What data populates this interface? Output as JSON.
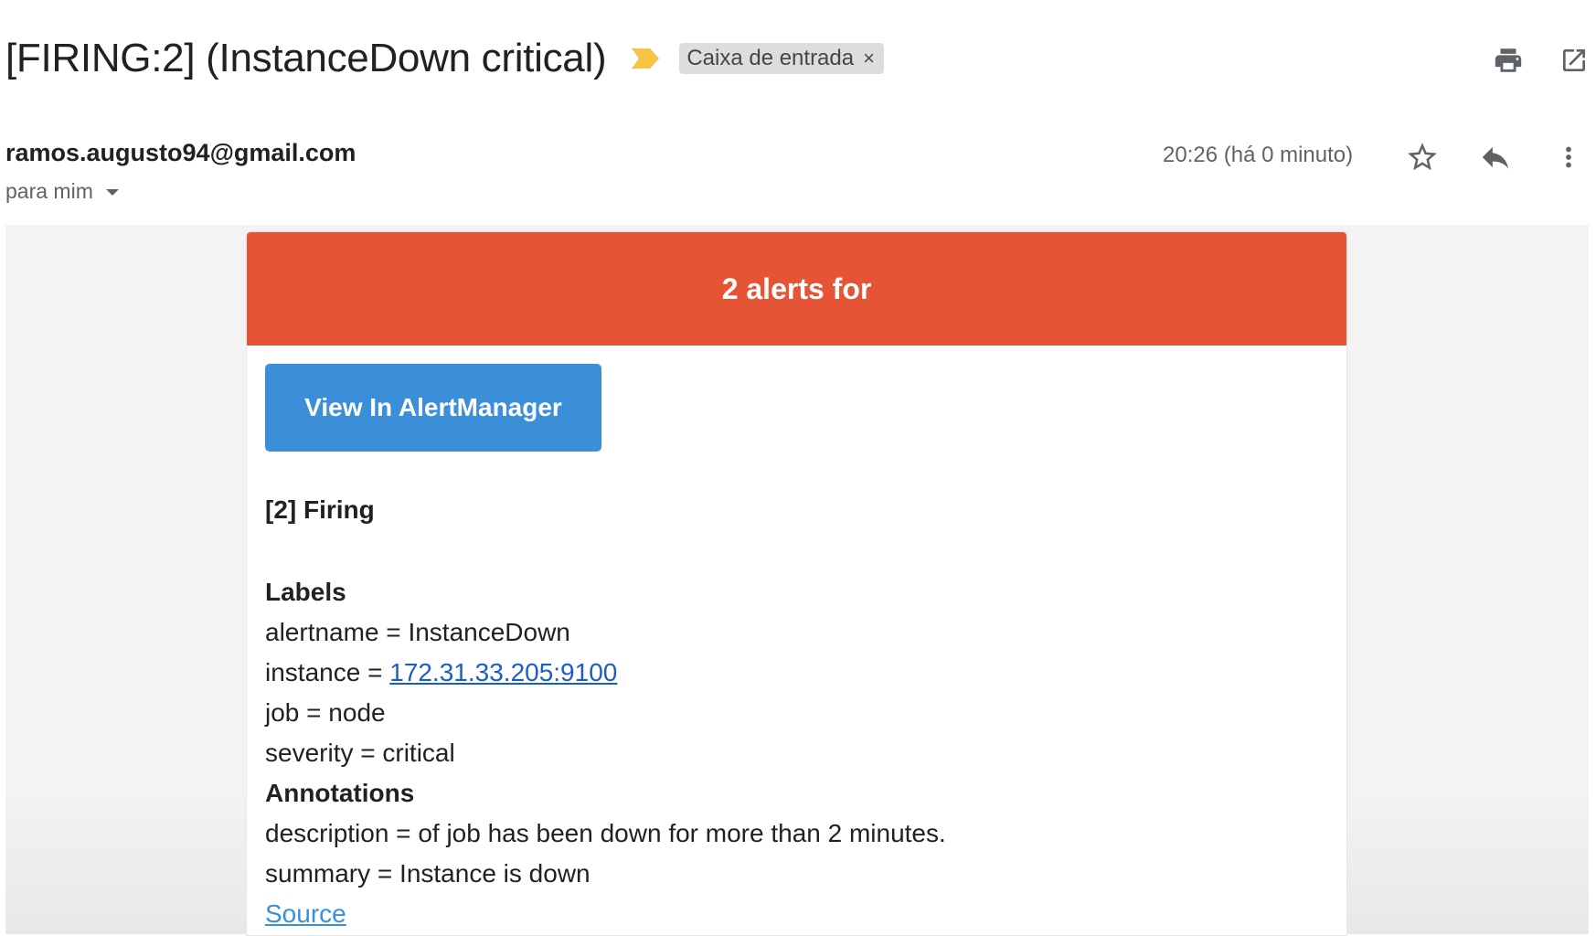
{
  "email": {
    "subject": "[FIRING:2] (InstanceDown critical)",
    "label_chip": "Caixa de entrada",
    "label_chip_close": "×",
    "sender": "ramos.augusto94@gmail.com",
    "recipient": "para mim",
    "timestamp": "20:26 (há 0 minuto)"
  },
  "icons": {
    "importance": "importance-marker-icon",
    "print": "print-icon",
    "open_new_window": "open-in-new-window-icon",
    "star": "star-icon",
    "reply": "reply-icon",
    "more": "more-vertical-icon"
  },
  "alert": {
    "banner_title": "2 alerts for",
    "button_label": "View In AlertManager",
    "firing_heading": "[2] Firing",
    "labels_heading": "Labels",
    "labels": [
      {
        "key": "alertname",
        "sep": " = ",
        "value": "InstanceDown"
      },
      {
        "key": "instance",
        "sep": " = ",
        "value": "172.31.33.205:9100"
      },
      {
        "key": "job",
        "sep": " = ",
        "value": "node"
      },
      {
        "key": "severity",
        "sep": " = ",
        "value": "critical"
      }
    ],
    "annotations_heading": "Annotations",
    "annotations": [
      {
        "key": "description",
        "sep": " = ",
        "value": "of job has been down for more than 2 minutes."
      },
      {
        "key": "summary",
        "sep": " = ",
        "value": "Instance is down"
      }
    ],
    "source_link": "Source"
  },
  "colors": {
    "banner": "#e45435",
    "button": "#3b8fd9",
    "importance": "#f6c343",
    "link": "#1a5dc8"
  }
}
